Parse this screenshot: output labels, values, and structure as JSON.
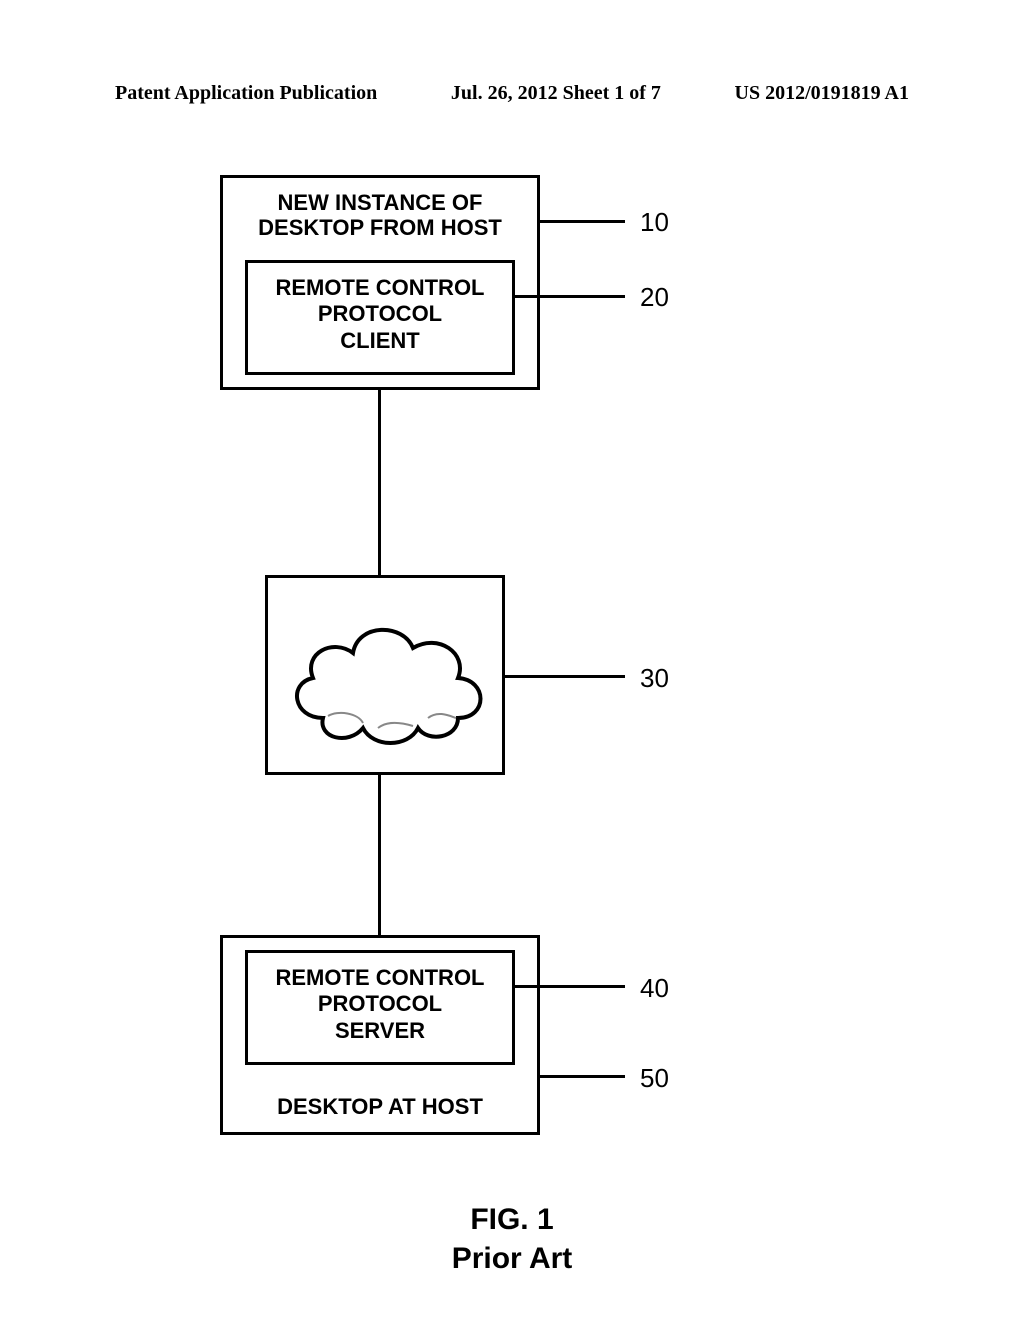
{
  "header": {
    "left": "Patent Application Publication",
    "center": "Jul. 26, 2012  Sheet 1 of 7",
    "right": "US 2012/0191819 A1"
  },
  "diagram": {
    "host_top_line1": "NEW INSTANCE OF",
    "host_top_line2": "DESKTOP FROM HOST",
    "client_line1": "REMOTE CONTROL",
    "client_line2": "PROTOCOL",
    "client_line3": "CLIENT",
    "server_line1": "REMOTE CONTROL",
    "server_line2": "PROTOCOL",
    "server_line3": "SERVER",
    "host_bottom_label": "DESKTOP AT HOST",
    "ref10": "10",
    "ref20": "20",
    "ref30": "30",
    "ref40": "40",
    "ref50": "50"
  },
  "caption": {
    "fig": "FIG. 1",
    "sub": "Prior Art"
  }
}
